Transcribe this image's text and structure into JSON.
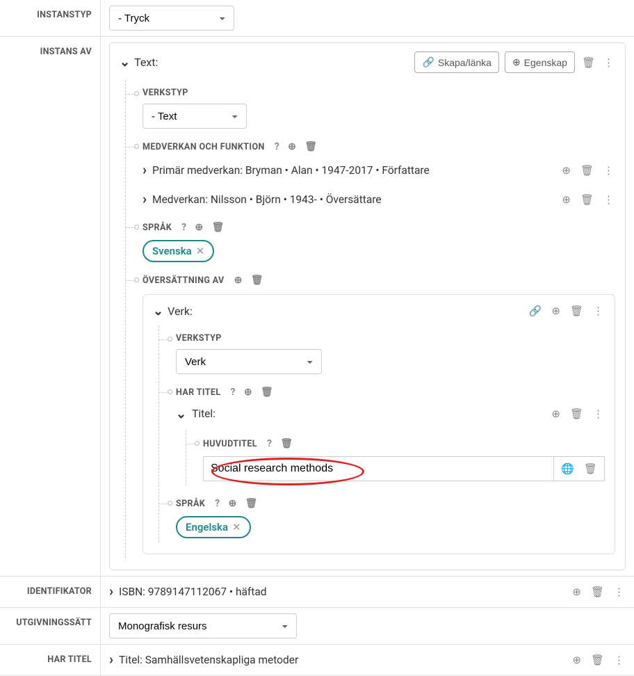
{
  "rows": {
    "instanstyp": {
      "label": "INSTANSTYP",
      "value": "- Tryck"
    },
    "instansav": {
      "label": "INSTANS AV"
    },
    "identifikator": {
      "label": "IDENTIFIKATOR",
      "line": "ISBN: 9789147112067 • häftad"
    },
    "utgivningssatt": {
      "label": "UTGIVNINGSSÄTT",
      "value": "Monografisk resurs"
    },
    "hartitel": {
      "label": "HAR TITEL",
      "line": "Titel: Samhällsvetenskapliga metoder"
    }
  },
  "panel": {
    "title": "Text:",
    "btn_skapa": "Skapa/länka",
    "btn_egenskap": "Egenskap",
    "verkstyp_label": "VERKSTYP",
    "verkstyp_value": "- Text",
    "medverkan_label": "MEDVERKAN OCH FUNKTION",
    "primar": "Primär medverkan: Bryman • Alan • 1947-2017 • Författare",
    "medverkan2": "Medverkan: Nilsson • Björn • 1943- • Översättare",
    "sprak_label": "SPRÅK",
    "sprak_pill": "Svenska",
    "oversattning_label": "ÖVERSÄTTNING AV"
  },
  "nested": {
    "title": "Verk:",
    "verkstyp_label": "VERKSTYP",
    "verkstyp_value": "Verk",
    "hartitel_label": "HAR TITEL",
    "titel_title": "Titel:",
    "huvudtitel_label": "HUVUDTITEL",
    "huvudtitel_value": "Social research methods",
    "sprak_label": "SPRÅK",
    "sprak_pill": "Engelska"
  }
}
